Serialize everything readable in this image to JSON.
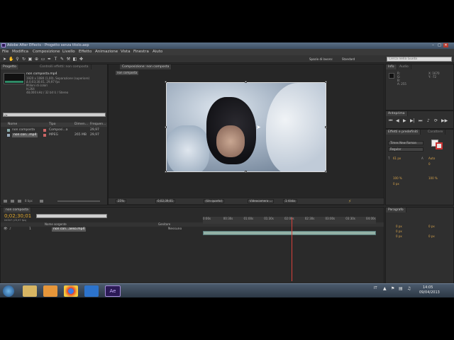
{
  "window": {
    "title": "Adobe After Effects - Progetto senza titolo.aep"
  },
  "menu": [
    "File",
    "Modifica",
    "Composizione",
    "Livello",
    "Effetto",
    "Animazione",
    "Vista",
    "Finestra",
    "Aiuto"
  ],
  "toolbar": {
    "workspace_label": "Spazio di lavoro:",
    "workspace_value": "Standard",
    "search_placeholder": "Cerca nella Guida"
  },
  "project_panel": {
    "tab": "Progetto",
    "effects_tab": "Controlli effetti: non composta",
    "item_name": "non composta.mp4",
    "item_meta": [
      "1920 x 1080 (1,00), Separazione (superiore)",
      "Δ 0;03;30;01, 29,97 fps",
      "Milioni di colori",
      "H.264",
      "48,000 kHz / 32 bit U / Stereo"
    ],
    "search_placeholder": "ρ▾",
    "columns": [
      "Nome",
      "Tipo",
      "Dimen...",
      "Frequen..."
    ],
    "rows": [
      {
        "name": "non composta",
        "type": "Composi...a",
        "size": "",
        "rate": "29,97"
      },
      {
        "name": "non con...mp4",
        "type": "MPEG",
        "size": "265 MB",
        "rate": "29,97"
      }
    ],
    "footer_bpc": "8 bpc"
  },
  "composition_panel": {
    "tab": "Composizione: non composta",
    "sub_tab": "non composta",
    "zoom": "25%",
    "time": "0;02;39;01",
    "resolution": "(Un quarto)",
    "camera": "Videocamera ...",
    "view": "1 Vista"
  },
  "info_panel": {
    "tab": "Info",
    "audio_tab": "Audio",
    "r": "R:",
    "g": "G:",
    "b": "B:",
    "a": "A: 255",
    "x": "X: 1670",
    "y": "Y: -72"
  },
  "preview_panel": {
    "tab": "Anteprima"
  },
  "effects_panel": {
    "tab": "Effetti e predefiniti",
    "character_tab": "Carattere",
    "font": "Times New Roman",
    "style": "Regular",
    "size": "61 px",
    "leading": "Auto",
    "tracking": "0",
    "scale_v": "100 %",
    "scale_h": "100 %",
    "baseline": "0 px"
  },
  "paragraph_panel": {
    "tab": "Paragrafo",
    "indent_values": [
      "0 px",
      "0 px",
      "0 px",
      "0 px",
      "0 px"
    ]
  },
  "timeline": {
    "tab": "non composta",
    "timecode": "0;02;30;01",
    "fps_note": "04507 (29,97 fps)",
    "columns": [
      "Nome sorgente",
      "Genitore"
    ],
    "layer": {
      "index": "1",
      "name": "non con...aeso.mp4",
      "parent": "Nessuno"
    },
    "ruler": [
      "0:00s",
      "00:30s",
      "01:00s",
      "01:30s",
      "02:00s",
      "02:30s",
      "03:00s",
      "03:30s",
      "04:00s"
    ],
    "footer": "Attiva/Disattiva switch/modalità",
    "playhead_fraction": 0.513
  },
  "taskbar": {
    "language": "IT",
    "time": "14:05",
    "date": "09/04/2013",
    "apps": [
      "windows-start",
      "explorer",
      "media-player",
      "chrome",
      "internet-explorer",
      "after-effects"
    ],
    "ae_label": "Ae"
  }
}
